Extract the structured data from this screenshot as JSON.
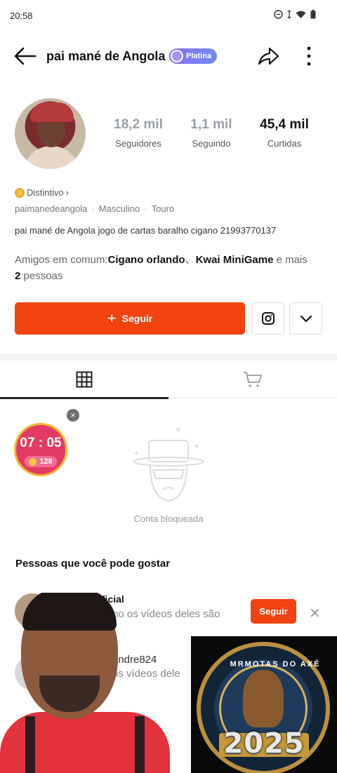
{
  "status_bar": {
    "time": "20:58",
    "icons": [
      "dnd-icon",
      "data-arrows-icon",
      "wifi-icon",
      "battery-icon"
    ]
  },
  "header": {
    "title": "pai mané de Angola",
    "badge": "Platina",
    "back_icon": "back-arrow-icon",
    "share_icon": "share-icon",
    "more_icon": "more-vertical-icon"
  },
  "profile": {
    "stats": [
      {
        "value": "18,2 mil",
        "label": "Seguidores"
      },
      {
        "value": "1,1 mil",
        "label": "Seguindo"
      },
      {
        "value": "45,4 mil",
        "label": "Curtidas"
      }
    ],
    "distintivo": "Distintivo",
    "username": "paimanedeangola",
    "gender": "Masculino",
    "sign": "Touro",
    "bio": "pai mané de Angola jogo de cartas baralho cigano 21993770137",
    "friends_prefix": "Amigos em comum:",
    "friend1": "Cigano orlando",
    "friend_sep": "、",
    "friend2": "Kwai MiniGame",
    "friends_more": " e mais",
    "friends_count": "2",
    "friends_suffix": " pessoas"
  },
  "actions": {
    "follow_label": "Seguir",
    "instagram_icon": "instagram-icon",
    "dropdown_icon": "chevron-down-icon"
  },
  "tabs": [
    {
      "name": "tab-grid",
      "icon": "grid-icon",
      "active": true
    },
    {
      "name": "tab-shop",
      "icon": "cart-icon",
      "active": false
    }
  ],
  "timer_widget": {
    "time": "07 : 05",
    "coins": "128",
    "close": "×"
  },
  "blocked": {
    "text": "Conta bloqueada"
  },
  "suggestions": {
    "title": "Pessoas que você pode gostar",
    "items": [
      {
        "name": "Oficial",
        "subtitle": "no os vídeos deles são",
        "follow_label": "Seguir",
        "close": "✕"
      },
      {
        "name": "andre824",
        "subtitle": "os vídeos dele"
      }
    ]
  },
  "logo": {
    "arc_text": "MRMOTAS DO AXÉ",
    "year": "2025"
  },
  "colors": {
    "accent": "#f1430f",
    "badge_start": "#8d6cf5",
    "timer": "#e43a63"
  }
}
